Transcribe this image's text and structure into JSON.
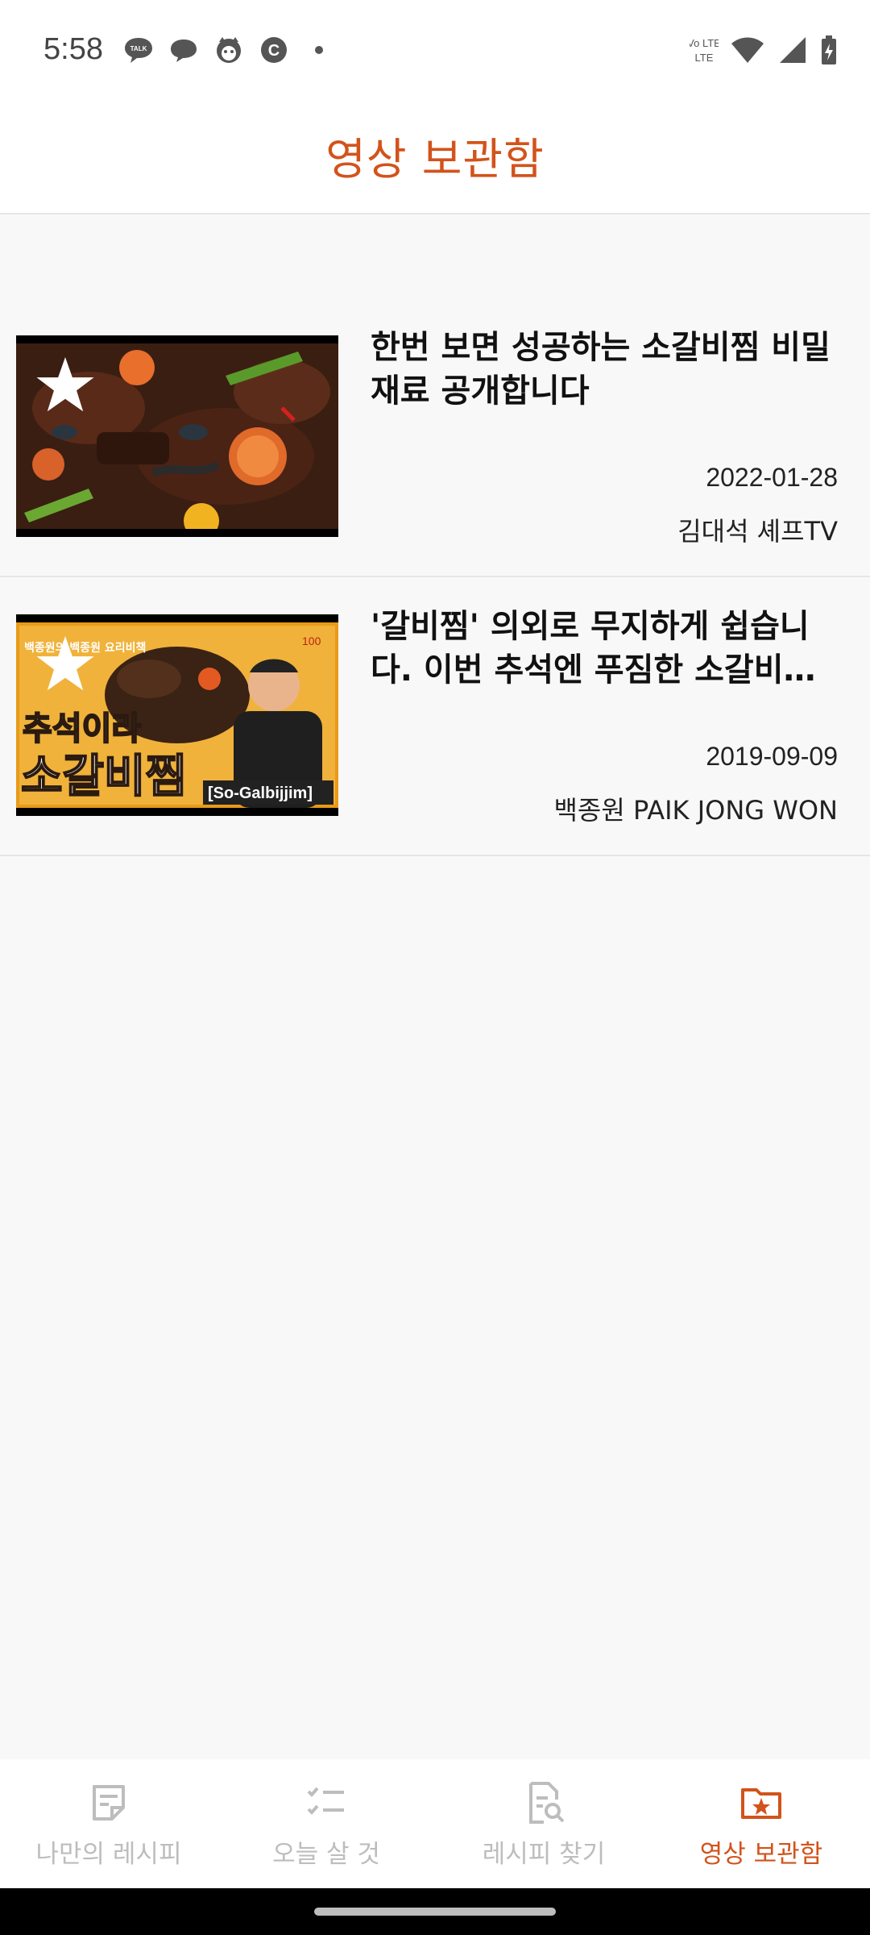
{
  "status_bar": {
    "time": "5:58",
    "notification_icons": [
      "kakaotalk-icon",
      "chat-bubble-icon",
      "cat-face-icon",
      "c-circle-icon",
      "dot-icon"
    ],
    "system_icons": [
      "volte-icon",
      "wifi-icon",
      "signal-icon",
      "battery-charging-icon"
    ],
    "volte_text": "Vo LTE",
    "talk_text": "TALK",
    "c_text": "C"
  },
  "header": {
    "title": "영상 보관함"
  },
  "videos": [
    {
      "title": "한번 보면 성공하는 소갈비찜 비밀 재료 공개합니다",
      "date": "2022-01-28",
      "channel": "김대석 셰프TV",
      "favorite": true
    },
    {
      "title": "'갈비찜' 의외로 무지하게 쉽습니다. 이번 추석엔 푸짐한 소갈비…",
      "date": "2019-09-09",
      "channel": "백종원 PAIK JONG WON",
      "favorite": true,
      "thumbnail_text": {
        "line1": "추석이라",
        "line2": "소갈비찜",
        "tag": "[So-Galbijjim]",
        "corner": "백종원의 백종원 요리비책",
        "badge": "100"
      }
    }
  ],
  "bottom_nav": {
    "items": [
      {
        "label": "나만의 레시피",
        "icon": "recipe-note-icon",
        "active": false
      },
      {
        "label": "오늘 살 것",
        "icon": "checklist-icon",
        "active": false
      },
      {
        "label": "레시피 찾기",
        "icon": "search-document-icon",
        "active": false
      },
      {
        "label": "영상 보관함",
        "icon": "folder-star-icon",
        "active": true
      }
    ]
  },
  "colors": {
    "accent": "#d2531b",
    "inactive": "#bdbdbd",
    "background": "#f8f8f8"
  }
}
